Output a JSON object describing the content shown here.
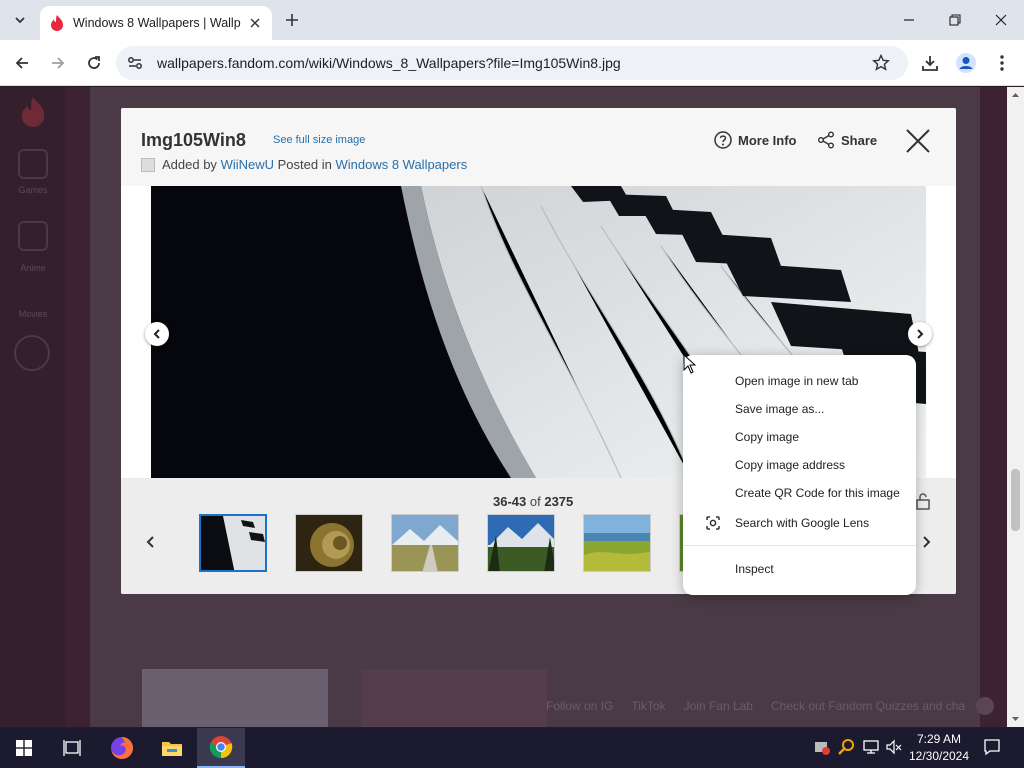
{
  "browser": {
    "tab_title": "Windows 8 Wallpapers | Wallpa",
    "url": "wallpapers.fandom.com/wiki/Windows_8_Wallpapers?file=Img105Win8.jpg"
  },
  "lightbox": {
    "title": "Img105Win8",
    "full_size_link": "See full size image",
    "added_by_prefix": "Added by",
    "added_by_user": "WiiNewU",
    "posted_in_prefix": "Posted in",
    "posted_in_link": "Windows 8 Wallpapers",
    "more_info": "More Info",
    "share": "Share",
    "counter_range": "36-43",
    "counter_of": "of",
    "counter_total": "2375"
  },
  "context_menu": {
    "items": [
      "Open image in new tab",
      "Save image as...",
      "Copy image",
      "Copy image address",
      "Create QR Code for this image",
      "Search with Google Lens",
      "Inspect"
    ]
  },
  "page_behind": {
    "sidebar_labels": [
      "Games",
      "Anime",
      "Movies"
    ],
    "banner_items": [
      "Follow on IG",
      "TikTok",
      "Join Fan Lab",
      "Check out Fandom Quizzes and cha"
    ]
  },
  "taskbar": {
    "time": "7:29 AM",
    "date": "12/30/2024"
  },
  "colors": {
    "link": "#2a6fa8",
    "active_thumb_border": "#1a73c8",
    "page_bg": "#3c2233"
  }
}
